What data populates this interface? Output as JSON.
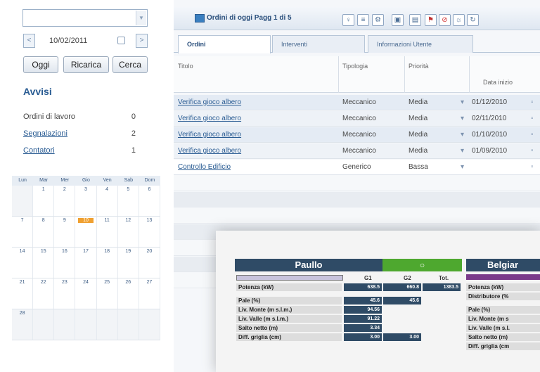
{
  "left": {
    "date": "10/02/2011",
    "buttons": {
      "today": "Oggi",
      "reload": "Ricarica",
      "search": "Cerca"
    },
    "alerts_title": "Avvisi",
    "alerts": [
      {
        "label": "Ordini di lavoro",
        "count": "0"
      },
      {
        "label": "Segnalazioni",
        "count": "2"
      },
      {
        "label": "Contatori",
        "count": "1"
      }
    ],
    "calendar": {
      "days": [
        "Lun",
        "Mar",
        "Mer",
        "Gio",
        "Ven",
        "Sab",
        "Dom"
      ],
      "weeks": [
        [
          "",
          "1",
          "2",
          "3",
          "4",
          "5",
          "6"
        ],
        [
          "7",
          "8",
          "9",
          "10",
          "11",
          "12",
          "13"
        ],
        [
          "14",
          "15",
          "16",
          "17",
          "18",
          "19",
          "20"
        ],
        [
          "21",
          "22",
          "23",
          "24",
          "25",
          "26",
          "27"
        ],
        [
          "28",
          "",
          "",
          "",
          "",
          "",
          ""
        ]
      ],
      "today": "10"
    }
  },
  "main": {
    "title": "Ordini di oggi Pagg 1 di 5",
    "tabs": [
      "Ordini",
      "Interventi",
      "Informazioni Utente"
    ],
    "columns": {
      "title": "Titolo",
      "type": "Tipologia",
      "priority": "Priorità",
      "start": "Data inizio"
    },
    "rows": [
      {
        "title": "Verifica gioco albero",
        "type": "Meccanico",
        "priority": "Media",
        "date": "01/12/2010"
      },
      {
        "title": "Verifica gioco albero",
        "type": "Meccanico",
        "priority": "Media",
        "date": "02/11/2010"
      },
      {
        "title": "Verifica gioco albero",
        "type": "Meccanico",
        "priority": "Media",
        "date": "01/10/2010"
      },
      {
        "title": "Verifica gioco albero",
        "type": "Meccanico",
        "priority": "Media",
        "date": "01/09/2010"
      },
      {
        "title": "Controllo Edificio",
        "type": "Generico",
        "priority": "Bassa",
        "date": ""
      }
    ]
  },
  "overlay": {
    "plant1": {
      "name": "Paullo",
      "columns": [
        "G1",
        "G2",
        "Tot."
      ],
      "rows": [
        {
          "label": "Potenza (kW)",
          "g1": "638.5",
          "g2": "660.8",
          "tot": "1383.5"
        },
        {
          "label": "Pale (%)",
          "g1": "45.6",
          "g2": "45.6",
          "tot": ""
        },
        {
          "label": "Liv. Monte (m s.l.m.)",
          "g1": "94.56",
          "g2": "",
          "tot": ""
        },
        {
          "label": "Liv. Valle (m s.l.m.)",
          "g1": "91.22",
          "g2": "",
          "tot": ""
        },
        {
          "label": "Salto netto (m)",
          "g1": "3.34",
          "g2": "",
          "tot": ""
        },
        {
          "label": "Diff. griglia (cm)",
          "g1": "3.00",
          "g2": "3.00",
          "tot": ""
        }
      ]
    },
    "plant2": {
      "name": "Belgiar",
      "rows": [
        "Potenza (kW)",
        "Distributore (%",
        "Pale (%)",
        "Liv. Monte (m s",
        "Liv. Valle (m s.l.",
        "Salto netto (m)",
        "Diff. griglia (cm"
      ]
    }
  },
  "colors": {
    "accent": "#2a5c93",
    "header_dark": "#2f4b66",
    "green": "#4ea82f",
    "today": "#f0a030"
  }
}
